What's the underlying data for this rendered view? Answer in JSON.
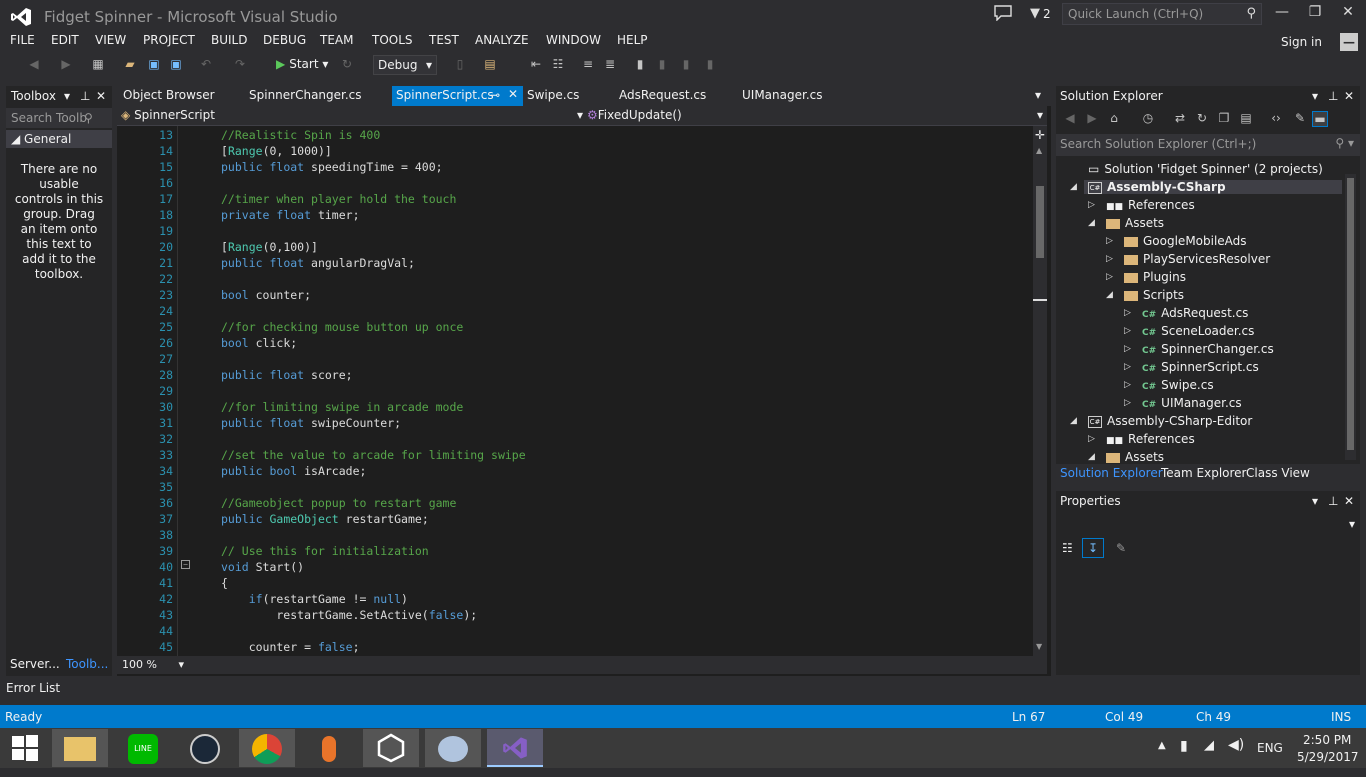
{
  "window": {
    "title": "Fidget Spinner - Microsoft Visual Studio",
    "notification_count": "2",
    "quick_launch_placeholder": "Quick Launch (Ctrl+Q)"
  },
  "menu": [
    "FILE",
    "EDIT",
    "VIEW",
    "PROJECT",
    "BUILD",
    "DEBUG",
    "TEAM",
    "TOOLS",
    "TEST",
    "ANALYZE",
    "WINDOW",
    "HELP"
  ],
  "signin": "Sign in",
  "toolbar": {
    "start_label": "Start",
    "config": "Debug"
  },
  "toolbox": {
    "title": "Toolbox",
    "search_placeholder": "Search Toolb",
    "group": "General",
    "empty_text": "There are no usable controls in this group. Drag an item onto this text to add it to the toolbox.",
    "tab_server": "Server...",
    "tab_toolbox": "Toolb..."
  },
  "editor": {
    "tabs": [
      "Object Browser",
      "SpinnerChanger.cs",
      "SpinnerScript.cs",
      "Swipe.cs",
      "AdsRequest.cs",
      "UIManager.cs"
    ],
    "active_tab": "SpinnerScript.cs",
    "class_dropdown": "SpinnerScript",
    "member_dropdown": "FixedUpdate()",
    "zoom": "100 %",
    "lines": [
      {
        "n": "13",
        "t": "//Realistic Spin is 400",
        "k": "cm"
      },
      {
        "n": "14",
        "t": "[Range(0, 1000)]",
        "k": "attr"
      },
      {
        "n": "15",
        "t": "public float speedingTime = 400;",
        "k": "decl"
      },
      {
        "n": "16",
        "t": "",
        "k": ""
      },
      {
        "n": "17",
        "t": "//timer when player hold the touch",
        "k": "cm"
      },
      {
        "n": "18",
        "t": "private float timer;",
        "k": "decl"
      },
      {
        "n": "19",
        "t": "",
        "k": ""
      },
      {
        "n": "20",
        "t": "[Range(0,100)]",
        "k": "attr"
      },
      {
        "n": "21",
        "t": "public float angularDragVal;",
        "k": "decl"
      },
      {
        "n": "22",
        "t": "",
        "k": ""
      },
      {
        "n": "23",
        "t": "bool counter;",
        "k": "decl"
      },
      {
        "n": "24",
        "t": "",
        "k": ""
      },
      {
        "n": "25",
        "t": "//for checking mouse button up once",
        "k": "cm"
      },
      {
        "n": "26",
        "t": "bool click;",
        "k": "decl"
      },
      {
        "n": "27",
        "t": "",
        "k": ""
      },
      {
        "n": "28",
        "t": "public float score;",
        "k": "decl"
      },
      {
        "n": "29",
        "t": "",
        "k": ""
      },
      {
        "n": "30",
        "t": "//for limiting swipe in arcade mode",
        "k": "cm"
      },
      {
        "n": "31",
        "t": "public float swipeCounter;",
        "k": "decl"
      },
      {
        "n": "32",
        "t": "",
        "k": ""
      },
      {
        "n": "33",
        "t": "//set the value to arcade for limiting swipe",
        "k": "cm"
      },
      {
        "n": "34",
        "t": "public bool isArcade;",
        "k": "decl"
      },
      {
        "n": "35",
        "t": "",
        "k": ""
      },
      {
        "n": "36",
        "t": "//Gameobject popup to restart game",
        "k": "cm"
      },
      {
        "n": "37",
        "t": "public GameObject restartGame;",
        "k": "decl"
      },
      {
        "n": "38",
        "t": "",
        "k": ""
      },
      {
        "n": "39",
        "t": "// Use this for initialization",
        "k": "cm"
      },
      {
        "n": "40",
        "t": "void Start()",
        "k": "decl"
      },
      {
        "n": "41",
        "t": "{",
        "k": ""
      },
      {
        "n": "42",
        "t": "    if(restartGame != null)",
        "k": "decl"
      },
      {
        "n": "43",
        "t": "        restartGame.SetActive(false);",
        "k": "decl"
      },
      {
        "n": "44",
        "t": "",
        "k": ""
      },
      {
        "n": "45",
        "t": "    counter = false;",
        "k": "decl"
      }
    ]
  },
  "solution_explorer": {
    "title": "Solution Explorer",
    "search_placeholder": "Search Solution Explorer (Ctrl+;)",
    "items": [
      {
        "label": "Solution 'Fidget Spinner' (2 projects)",
        "depth": 0,
        "icon": "solution",
        "arrow": ""
      },
      {
        "label": "Assembly-CSharp",
        "depth": 0,
        "icon": "project",
        "arrow": "open",
        "bold": true
      },
      {
        "label": "References",
        "depth": 1,
        "icon": "references",
        "arrow": "closed"
      },
      {
        "label": "Assets",
        "depth": 1,
        "icon": "folder",
        "arrow": "open"
      },
      {
        "label": "GoogleMobileAds",
        "depth": 2,
        "icon": "folder",
        "arrow": "closed"
      },
      {
        "label": "PlayServicesResolver",
        "depth": 2,
        "icon": "folder",
        "arrow": "closed"
      },
      {
        "label": "Plugins",
        "depth": 2,
        "icon": "folder",
        "arrow": "closed"
      },
      {
        "label": "Scripts",
        "depth": 2,
        "icon": "folder",
        "arrow": "open"
      },
      {
        "label": "AdsRequest.cs",
        "depth": 3,
        "icon": "cs",
        "arrow": "closed"
      },
      {
        "label": "SceneLoader.cs",
        "depth": 3,
        "icon": "cs",
        "arrow": "closed"
      },
      {
        "label": "SpinnerChanger.cs",
        "depth": 3,
        "icon": "cs",
        "arrow": "closed"
      },
      {
        "label": "SpinnerScript.cs",
        "depth": 3,
        "icon": "cs",
        "arrow": "closed"
      },
      {
        "label": "Swipe.cs",
        "depth": 3,
        "icon": "cs",
        "arrow": "closed"
      },
      {
        "label": "UIManager.cs",
        "depth": 3,
        "icon": "cs",
        "arrow": "closed"
      },
      {
        "label": "Assembly-CSharp-Editor",
        "depth": 0,
        "icon": "project",
        "arrow": "open"
      },
      {
        "label": "References",
        "depth": 1,
        "icon": "references",
        "arrow": "closed"
      },
      {
        "label": "Assets",
        "depth": 1,
        "icon": "folder",
        "arrow": "open"
      }
    ],
    "tabs": [
      "Solution Explorer",
      "Team Explorer",
      "Class View"
    ]
  },
  "properties": {
    "title": "Properties"
  },
  "error_list": "Error List",
  "status": {
    "text": "Ready",
    "ln": "Ln 67",
    "col": "Col 49",
    "ch": "Ch 49",
    "mode": "INS"
  },
  "taskbar": {
    "lang": "ENG",
    "time": "2:50 PM",
    "date": "5/29/2017"
  },
  "colors": {
    "accent": "#007acc",
    "background": "#2d2d30",
    "editor": "#1e1e1e",
    "comment": "#57a64a",
    "keyword": "#569cd6",
    "type": "#4ec9b0"
  }
}
